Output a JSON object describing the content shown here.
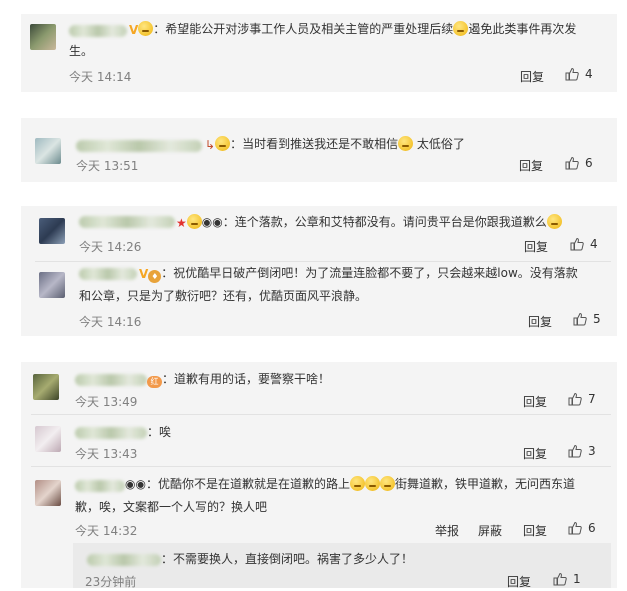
{
  "colors": {
    "card_bg": "#f4f4f4",
    "time": "#808080",
    "text": "#333333",
    "emoji": "#f4c430"
  },
  "comments": {
    "c1": {
      "text_a": "：希望能公开对涉事工作人员及相关主管的严重处理后续",
      "text_b": "遏免此类事件再次发",
      "text_c": "生。",
      "time": "今天 14:14",
      "reply": "回复",
      "likes": "4"
    },
    "c2": {
      "text_a": "：当时看到推送我还是不敢相信",
      "text_b": "太低俗了",
      "time": "今天 13:51",
      "reply": "回复",
      "likes": "6"
    },
    "c3": {
      "text_a": "：连个落款，公章和艾特都没有。请问贵平台是你跟我道歉么",
      "time": "今天 14:26",
      "reply": "回复",
      "likes": "4"
    },
    "c4": {
      "text_a": "：祝优酷早日破产倒闭吧！为了流量连脸都不要了，只会越来越low。没有落款",
      "text_b": "和公章，只是为了敷衍吧？还有，优酷页面风平浪静。",
      "time": "今天 14:16",
      "reply": "回复",
      "likes": "5"
    },
    "c5": {
      "text_a": "：道歉有用的话，要警察干啥！",
      "time": "今天 13:49",
      "reply": "回复",
      "likes": "7"
    },
    "c6": {
      "text_a": "：唉",
      "time": "今天 13:43",
      "reply": "回复",
      "likes": "3"
    },
    "c7": {
      "text_a": "：优酷你不是在道歉就是在道歉的路上",
      "text_b": "街舞道歉，铁甲道歉，无问西东道",
      "text_c": "歉，唉，文案都一个人写的？换人吧",
      "time": "今天 14:32",
      "report": "举报",
      "block": "屏蔽",
      "reply": "回复",
      "likes": "6"
    },
    "c8": {
      "text_a": "：不需要换人，直接倒闭吧。祸害了多少人了！",
      "time": "23分钟前",
      "reply": "回复",
      "likes": "1"
    }
  },
  "icons": {
    "like": "thumbs-up-icon",
    "smile": "smile-emoji-icon",
    "vip": "v-badge-icon",
    "star": "star-icon",
    "panda": "panda-icon"
  }
}
